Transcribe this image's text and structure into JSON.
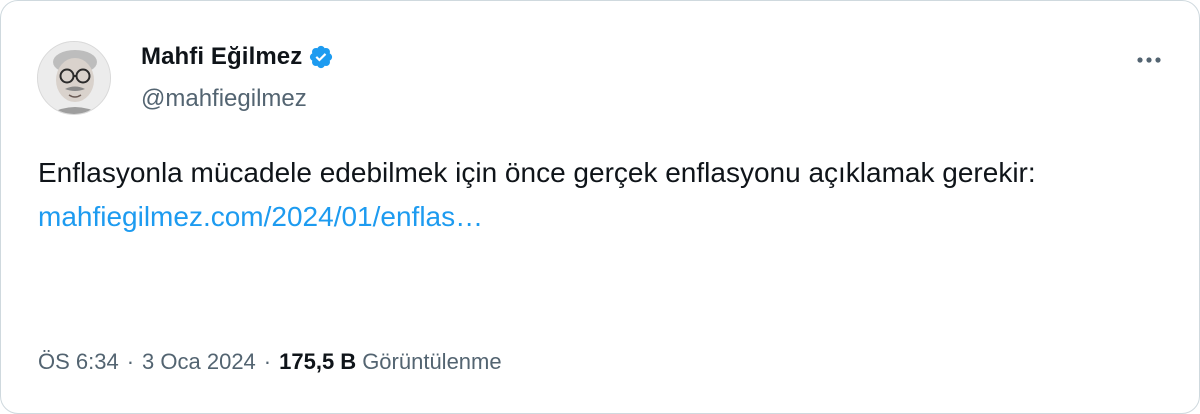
{
  "author": {
    "name": "Mahfi Eğilmez",
    "handle": "@mahfiegilmez",
    "verified": true,
    "verified_color": "#1d9bf0",
    "avatar_icon": "profile-photo"
  },
  "tweet": {
    "text_line": "Enflasyonla mücadele edebilmek için önce gerçek enflasyonu açıklamak gerekir:",
    "link_text": "mahfiegilmez.com/2024/01/enflas…",
    "link_color": "#1d9bf0"
  },
  "meta": {
    "time": "ÖS 6:34",
    "separator": "·",
    "date": "3 Oca 2024",
    "views_count": "175,5 B",
    "views_label": "Görüntülenme"
  },
  "menu": {
    "icon": "more-icon"
  }
}
